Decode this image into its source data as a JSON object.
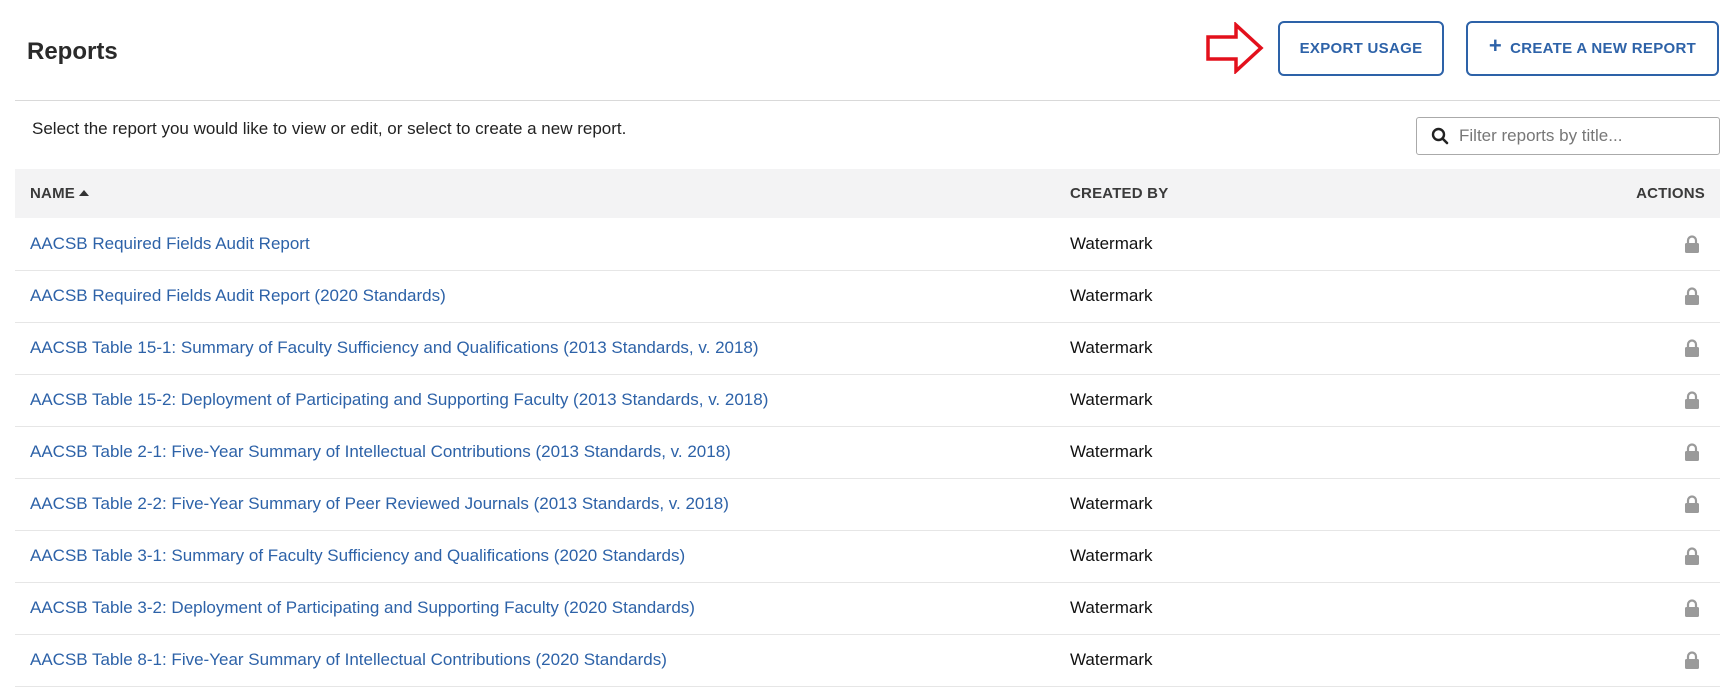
{
  "header": {
    "title": "Reports",
    "export_label": "EXPORT USAGE",
    "create_label": "CREATE A NEW REPORT",
    "create_icon": "plus-icon",
    "annotation_color": "#e3101c"
  },
  "subheader": {
    "instructions": "Select the report you would like to view or edit, or select to create a new report.",
    "filter_placeholder": "Filter reports by title...",
    "filter_value": ""
  },
  "table": {
    "columns": {
      "name": "NAME",
      "created_by": "CREATED BY",
      "actions": "ACTIONS"
    },
    "sort": {
      "column": "name",
      "direction": "ascending"
    },
    "rows": [
      {
        "name": "AACSB Required Fields Audit Report",
        "created_by": "Watermark",
        "action_icon": "lock-icon"
      },
      {
        "name": "AACSB Required Fields Audit Report (2020 Standards)",
        "created_by": "Watermark",
        "action_icon": "lock-icon"
      },
      {
        "name": "AACSB Table 15-1: Summary of Faculty Sufficiency and Qualifications (2013 Standards, v. 2018)",
        "created_by": "Watermark",
        "action_icon": "lock-icon"
      },
      {
        "name": "AACSB Table 15-2: Deployment of Participating and Supporting Faculty (2013 Standards, v. 2018)",
        "created_by": "Watermark",
        "action_icon": "lock-icon"
      },
      {
        "name": "AACSB Table 2-1: Five-Year Summary of Intellectual Contributions (2013 Standards, v. 2018)",
        "created_by": "Watermark",
        "action_icon": "lock-icon"
      },
      {
        "name": "AACSB Table 2-2: Five-Year Summary of Peer Reviewed Journals (2013 Standards, v. 2018)",
        "created_by": "Watermark",
        "action_icon": "lock-icon"
      },
      {
        "name": "AACSB Table 3-1: Summary of Faculty Sufficiency and Qualifications (2020 Standards)",
        "created_by": "Watermark",
        "action_icon": "lock-icon"
      },
      {
        "name": "AACSB Table 3-2: Deployment of Participating and Supporting Faculty (2020 Standards)",
        "created_by": "Watermark",
        "action_icon": "lock-icon"
      },
      {
        "name": "AACSB Table 8-1: Five-Year Summary of Intellectual Contributions (2020 Standards)",
        "created_by": "Watermark",
        "action_icon": "lock-icon"
      }
    ]
  },
  "colors": {
    "link": "#2d62a8",
    "button_border": "#2d62a8",
    "header_bg": "#f3f3f4",
    "lock": "#9a9a9a"
  }
}
